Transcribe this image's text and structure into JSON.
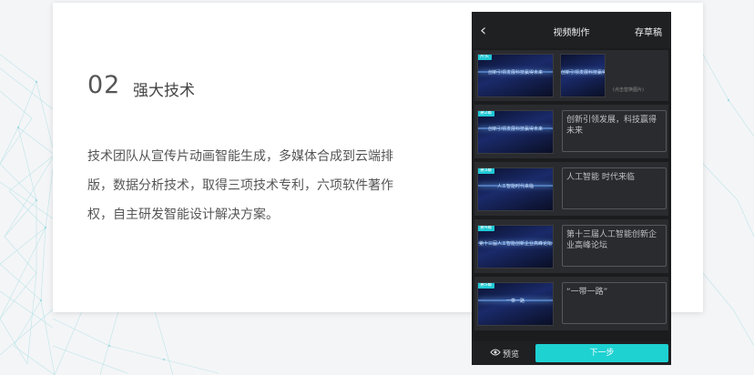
{
  "section": {
    "number": "02",
    "title": "强大技术",
    "body": "技术团队从宣传片动画智能生成，多媒体合成到云端排版，数据分析技术，取得三项技术专利，六项软件著作权，自主研发智能设计解决方案。"
  },
  "phone": {
    "header": {
      "title": "视频制作",
      "draft": "存草稿"
    },
    "rows": [
      {
        "badge": "片头",
        "thumbs": [
          "创新引领发展科技赢得未来",
          "创新引领发展科技赢得未来"
        ],
        "replace_hint": "(点击替换图片)"
      },
      {
        "badge": "第2幕",
        "caption": "创新引领发展科技赢得未来",
        "text": "创新引领发展，科技赢得未来"
      },
      {
        "badge": "第3幕",
        "caption": "人工智能时代来临",
        "text": "人工智能 时代来临"
      },
      {
        "badge": "第4幕",
        "caption": "第十三届人工智能创新企业高峰论坛",
        "text": "第十三届人工智能创新企业高峰论坛"
      },
      {
        "badge": "第5幕",
        "caption": "一带一路",
        "text": "“一带一路”"
      }
    ],
    "footer": {
      "preview": "预览",
      "next": "下一步"
    }
  },
  "colors": {
    "accent": "#1ed2d2",
    "phone_bg": "#1b1c1e"
  }
}
